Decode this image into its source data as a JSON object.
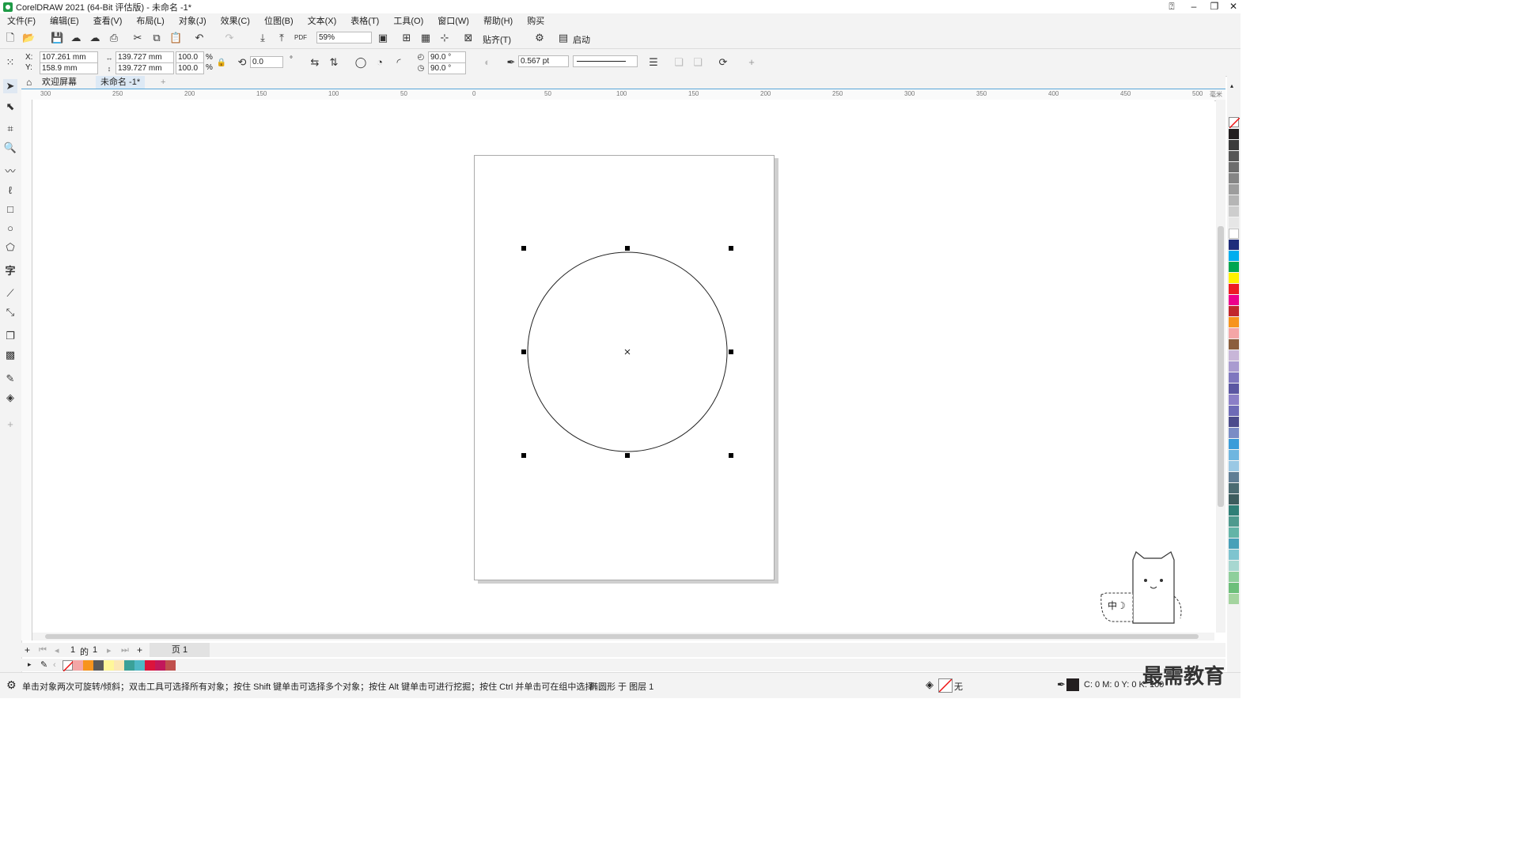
{
  "window": {
    "title": "CorelDRAW 2021 (64-Bit 评估版) - 未命名 -1*"
  },
  "menu": [
    "文件(F)",
    "编辑(E)",
    "查看(V)",
    "布局(L)",
    "对象(J)",
    "效果(C)",
    "位图(B)",
    "文本(X)",
    "表格(T)",
    "工具(O)",
    "窗口(W)",
    "帮助(H)",
    "购买"
  ],
  "toolbar": {
    "zoom": "59%",
    "snap_label": "贴齐(T)",
    "launch_label": "启动"
  },
  "properties": {
    "x_label": "X:",
    "y_label": "Y:",
    "x": "107.261 mm",
    "y": "158.9 mm",
    "width": "139.727 mm",
    "height": "139.727 mm",
    "scale_x": "100.0",
    "scale_y": "100.0",
    "percent": "%",
    "rotation": "0.0",
    "degree_symbol": "°",
    "start_angle": "90.0 °",
    "end_angle": "90.0 °",
    "outline_width": "0.567 pt"
  },
  "tabs": [
    "欢迎屏幕",
    "未命名 -1*"
  ],
  "ruler": {
    "h": [
      "300",
      "250",
      "200",
      "150",
      "100",
      "50",
      "0",
      "50",
      "100",
      "150",
      "200",
      "250",
      "300",
      "350",
      "400",
      "450",
      "500"
    ],
    "unit": "毫米"
  },
  "pagenav": {
    "current": "1",
    "of": "的",
    "total": "1",
    "page_tab": "页 1"
  },
  "status": {
    "hint": "单击对象两次可旋转/倾斜；双击工具可选择所有对象；按住 Shift 键单击可选择多个对象；按住 Alt 键单击可进行挖掘；按住 Ctrl 并单击可在组中选择",
    "object_info": "椭圆形 于 图层 1",
    "fill_label": "无",
    "outline_cmyk": "C: 0 M: 0 Y: 0 K: 100"
  },
  "watermark": "最需教育",
  "colors": {
    "accent": "#58a6d8",
    "doc_palette": [
      "#ffffff",
      "#f4a6a6",
      "#f7941d",
      "#5a5a5a",
      "#fff799",
      "#fbe7b5",
      "#3aa198",
      "#4fb8c5",
      "#dc143c",
      "#c2185b",
      "#c0504d"
    ],
    "right_palette": [
      "#231f20",
      "#3b3b3b",
      "#565656",
      "#6d6d6d",
      "#858585",
      "#9d9d9d",
      "#b5b5b5",
      "#cdcdcd",
      "#e6e6e6",
      "#ffffff",
      "#1f2d7b",
      "#00aeef",
      "#00a651",
      "#fff200",
      "#ed1c24",
      "#ec008c",
      "#c1272d",
      "#f7941d",
      "#f4a6a6",
      "#8b5e3c",
      "#c8b6d8",
      "#a99bd0",
      "#7f77bf",
      "#5b57a2",
      "#8b7fc7",
      "#6e6bb7",
      "#4c4c8c",
      "#7a8cc5",
      "#3b9cd9",
      "#6fb6e0",
      "#9ac8e4",
      "#5f7d94",
      "#4b6b72",
      "#3d5c5e",
      "#2f7f77",
      "#4e9a8e",
      "#63b4a7",
      "#48a0b8",
      "#7ec4cf",
      "#a7d7d0",
      "#8fcf9c",
      "#6cbf7a",
      "#a4d49f"
    ]
  }
}
